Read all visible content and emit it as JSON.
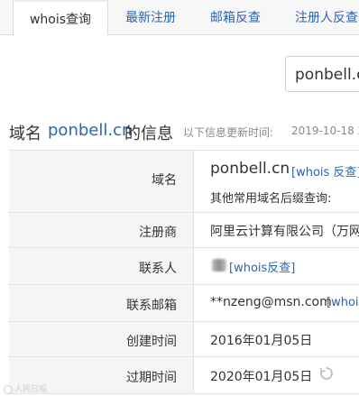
{
  "tabs": [
    {
      "label": "whois查询",
      "active": true
    },
    {
      "label": "最新注册",
      "active": false
    },
    {
      "label": "邮箱反查",
      "active": false
    },
    {
      "label": "注册人反查",
      "active": false
    }
  ],
  "search": {
    "value": "ponbell.cn"
  },
  "title": {
    "prefix": "域名",
    "domain": "ponbell.cn",
    "suffix": "的信息",
    "update_label": "以下信息更新时间:",
    "update_time": "2019-10-18 2"
  },
  "rows": {
    "domain": {
      "label": "域名",
      "value": "ponbell.cn",
      "link": "[whois 反查]",
      "note": "其他常用域名后缀查询:"
    },
    "registrar": {
      "label": "注册商",
      "value": "阿里云计算有限公司（万网"
    },
    "contact": {
      "label": "联系人",
      "value_tail": "s",
      "link": "[whois反查]"
    },
    "email": {
      "label": "联系邮箱",
      "value": "**nzeng@msn.com",
      "link": "[whois"
    },
    "created": {
      "label": "创建时间",
      "value": "2016年01月05日"
    },
    "expires": {
      "label": "过期时间",
      "value": "2020年01月05日"
    }
  },
  "icons": {
    "refresh": "refresh-icon",
    "watermark": "watermark-logo-icon"
  },
  "watermark": {
    "text": "人民日报"
  },
  "colors": {
    "link": "#2c64b0",
    "label_bg": "#f5f5f5",
    "border": "#e2e2e2"
  }
}
